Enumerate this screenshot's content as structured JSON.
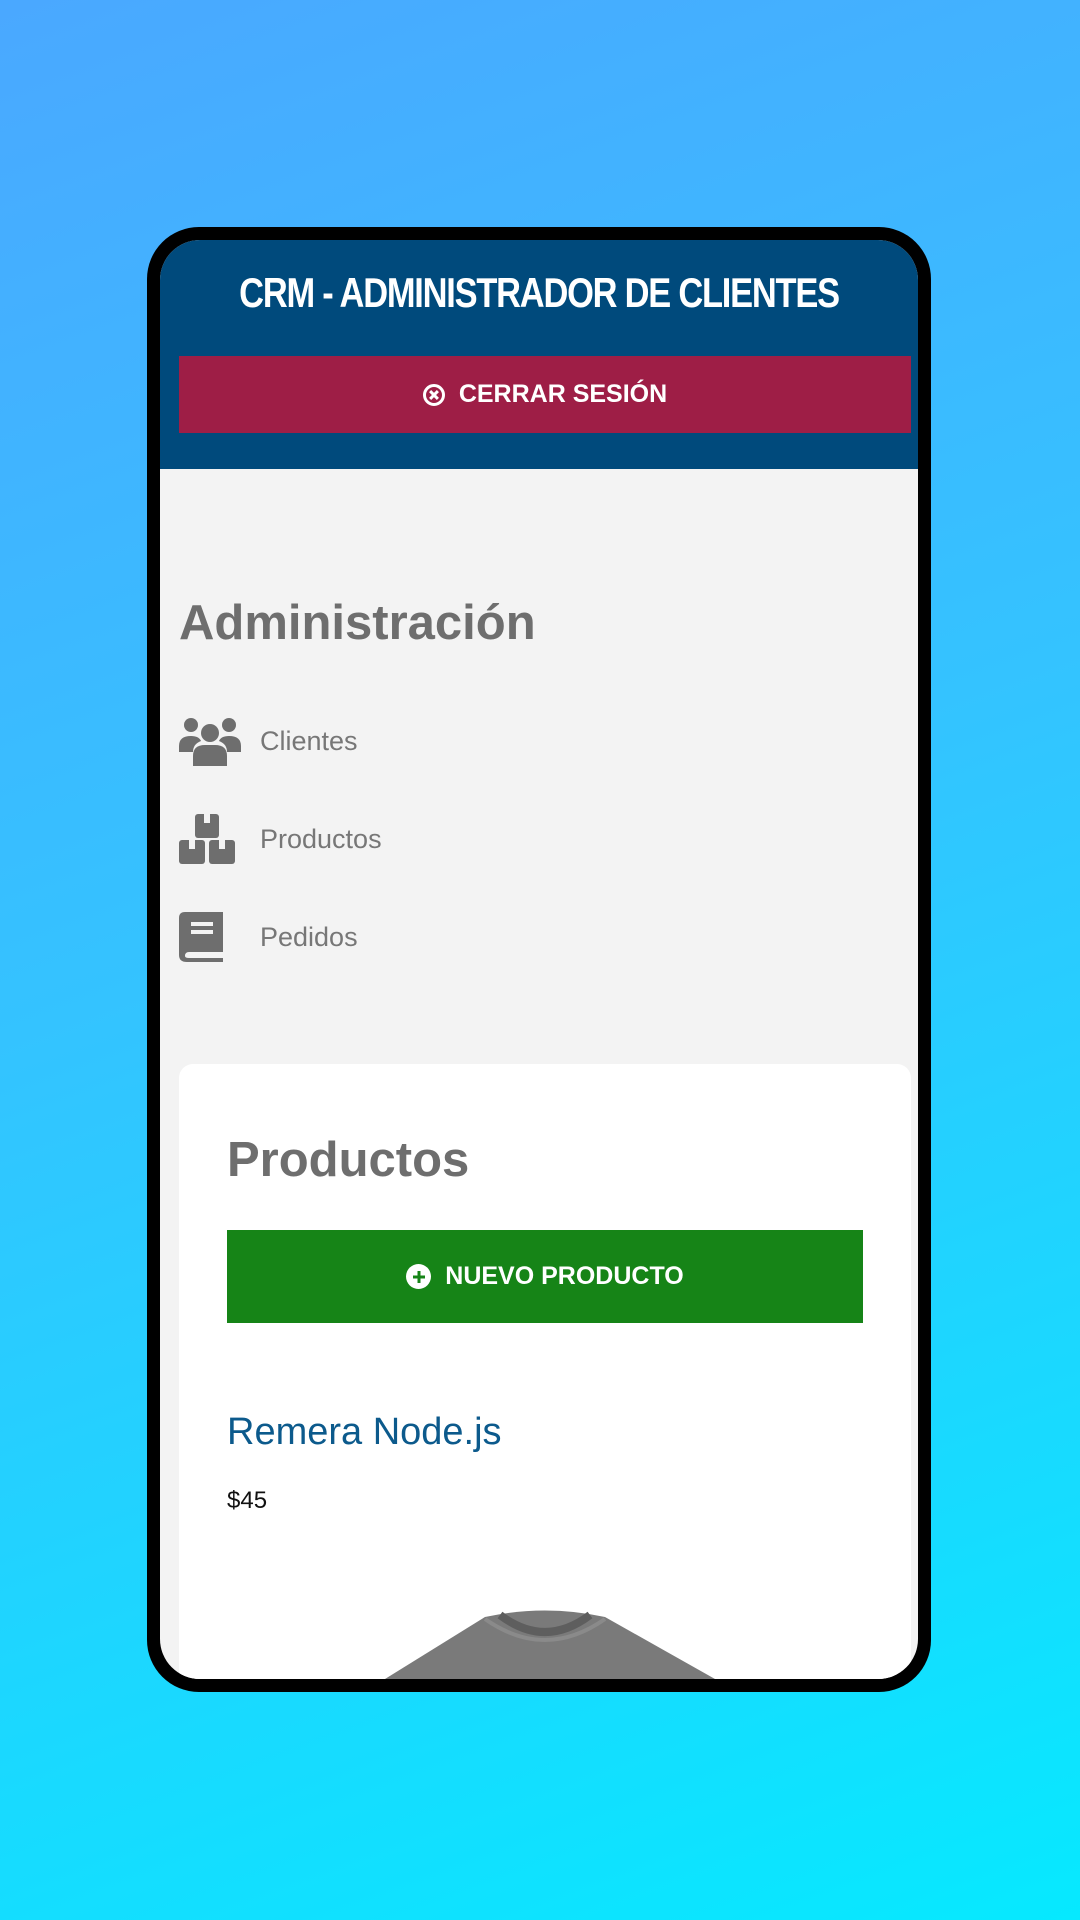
{
  "header": {
    "title": "CRM - ADMINISTRADOR DE CLIENTES",
    "logout_label": "CERRAR SESIÓN"
  },
  "sidebar": {
    "title": "Administración",
    "items": [
      {
        "label": "Clientes",
        "icon": "users-icon"
      },
      {
        "label": "Productos",
        "icon": "boxes-icon"
      },
      {
        "label": "Pedidos",
        "icon": "book-icon"
      }
    ]
  },
  "main": {
    "title": "Productos",
    "new_button_label": "NUEVO PRODUCTO",
    "products": [
      {
        "name": "Remera Node.js",
        "price": "$45"
      }
    ]
  },
  "colors": {
    "header_bg": "#004a7c",
    "logout_bg": "#9e1e46",
    "new_button_bg": "#168417",
    "product_name": "#0c5a8c"
  }
}
